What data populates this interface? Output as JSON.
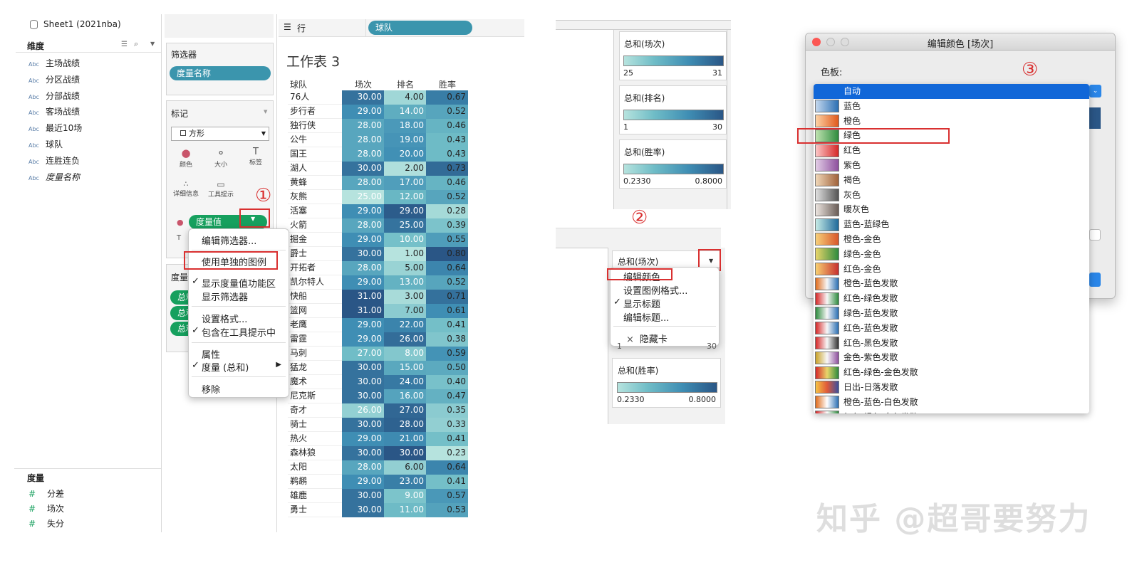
{
  "left_panel": {
    "sheet_title": "Sheet1 (2021nba)",
    "dimensions_label": "维度",
    "dimensions": [
      {
        "type": "Abc",
        "name": "主场战绩"
      },
      {
        "type": "Abc",
        "name": "分区战绩"
      },
      {
        "type": "Abc",
        "name": "分部战绩"
      },
      {
        "type": "Abc",
        "name": "客场战绩"
      },
      {
        "type": "Abc",
        "name": "最近10场"
      },
      {
        "type": "Abc",
        "name": "球队"
      },
      {
        "type": "Abc",
        "name": "连胜连负"
      },
      {
        "type": "Abc",
        "name": "度量名称"
      }
    ],
    "measures_label": "度量",
    "measures": [
      {
        "type": "#",
        "name": "分差"
      },
      {
        "type": "#",
        "name": "场次"
      },
      {
        "type": "#",
        "name": "失分"
      }
    ]
  },
  "filters": {
    "label": "筛选器",
    "pill": "度量名称"
  },
  "marks": {
    "label": "标记",
    "mark_type": "方形",
    "buttons": [
      "颜色",
      "大小",
      "标签",
      "详细信息",
      "工具提示"
    ],
    "pill": "度量值"
  },
  "measure_values_label": "度量",
  "measure_pills": [
    "总和",
    "总和",
    "总和"
  ],
  "rows": {
    "label": "行",
    "pill": "球队"
  },
  "sheet": {
    "title": "工作表 3",
    "headers": [
      "球队",
      "场次",
      "排名",
      "胜率"
    ],
    "rows": [
      [
        "76人",
        "30.00",
        "4.00",
        "0.67"
      ],
      [
        "步行者",
        "29.00",
        "14.00",
        "0.52"
      ],
      [
        "独行侠",
        "28.00",
        "18.00",
        "0.46"
      ],
      [
        "公牛",
        "28.00",
        "19.00",
        "0.43"
      ],
      [
        "国王",
        "28.00",
        "20.00",
        "0.43"
      ],
      [
        "湖人",
        "30.00",
        "2.00",
        "0.73"
      ],
      [
        "黄蜂",
        "28.00",
        "17.00",
        "0.46"
      ],
      [
        "灰熊",
        "25.00",
        "12.00",
        "0.52"
      ],
      [
        "活塞",
        "29.00",
        "29.00",
        "0.28"
      ],
      [
        "火箭",
        "28.00",
        "25.00",
        "0.39"
      ],
      [
        "掘金",
        "29.00",
        "10.00",
        "0.55"
      ],
      [
        "爵士",
        "30.00",
        "1.00",
        "0.80"
      ],
      [
        "开拓者",
        "28.00",
        "5.00",
        "0.64"
      ],
      [
        "凯尔特人",
        "29.00",
        "13.00",
        "0.52"
      ],
      [
        "快船",
        "31.00",
        "3.00",
        "0.71"
      ],
      [
        "篮网",
        "31.00",
        "7.00",
        "0.61"
      ],
      [
        "老鹰",
        "29.00",
        "22.00",
        "0.41"
      ],
      [
        "雷霆",
        "29.00",
        "26.00",
        "0.38"
      ],
      [
        "马刺",
        "27.00",
        "8.00",
        "0.59"
      ],
      [
        "猛龙",
        "30.00",
        "15.00",
        "0.50"
      ],
      [
        "魔术",
        "30.00",
        "24.00",
        "0.40"
      ],
      [
        "尼克斯",
        "30.00",
        "16.00",
        "0.47"
      ],
      [
        "奇才",
        "26.00",
        "27.00",
        "0.35"
      ],
      [
        "骑士",
        "30.00",
        "28.00",
        "0.33"
      ],
      [
        "热火",
        "29.00",
        "21.00",
        "0.41"
      ],
      [
        "森林狼",
        "30.00",
        "30.00",
        "0.23"
      ],
      [
        "太阳",
        "28.00",
        "6.00",
        "0.64"
      ],
      [
        "鹈鹕",
        "29.00",
        "23.00",
        "0.41"
      ],
      [
        "雄鹿",
        "30.00",
        "9.00",
        "0.57"
      ],
      [
        "勇士",
        "30.00",
        "11.00",
        "0.53"
      ]
    ]
  },
  "context_menu_1": {
    "items": [
      {
        "label": "编辑筛选器...",
        "check": false
      },
      {
        "label": "使用单独的图例",
        "check": false
      },
      {
        "label": "显示度量值功能区",
        "check": true
      },
      {
        "label": "显示筛选器",
        "check": false
      },
      {
        "label": "设置格式...",
        "check": false
      },
      {
        "label": "包含在工具提示中",
        "check": true
      },
      {
        "label": "属性",
        "check": false
      },
      {
        "label": "度量 (总和)",
        "check": true,
        "arrow": "▶"
      },
      {
        "label": "移除",
        "check": false
      }
    ]
  },
  "legends_top": [
    {
      "title": "总和(场次)",
      "min": "25",
      "max": "31"
    },
    {
      "title": "总和(排名)",
      "min": "1",
      "max": "30"
    },
    {
      "title": "总和(胜率)",
      "min": "0.2330",
      "max": "0.8000"
    }
  ],
  "legend_mid": {
    "title": "总和(场次)"
  },
  "legend_bottom": {
    "title": "总和(胜率)",
    "min": "0.2330",
    "max": "0.8000"
  },
  "context_menu_2": {
    "items": [
      {
        "label": "编辑颜色...",
        "check": false
      },
      {
        "label": "设置图例格式...",
        "check": false
      },
      {
        "label": "显示标题",
        "check": true
      },
      {
        "label": "编辑标题...",
        "check": false
      },
      {
        "label": "隐藏卡",
        "prefix": "×"
      }
    ]
  },
  "peek_values": {
    "a": "1",
    "b": "30"
  },
  "dialog": {
    "title": "编辑颜色 [场次]",
    "palette_label": "色板:",
    "palettes": [
      {
        "name": "自动",
        "selected": true
      },
      {
        "name": "蓝色"
      },
      {
        "name": "橙色"
      },
      {
        "name": "绿色"
      },
      {
        "name": "红色"
      },
      {
        "name": "紫色"
      },
      {
        "name": "褐色"
      },
      {
        "name": "灰色"
      },
      {
        "name": "暖灰色"
      },
      {
        "name": "蓝色-蓝绿色"
      },
      {
        "name": "橙色-金色"
      },
      {
        "name": "绿色-金色"
      },
      {
        "name": "红色-金色"
      },
      {
        "name": "橙色-蓝色发散"
      },
      {
        "name": "红色-绿色发散"
      },
      {
        "name": "绿色-蓝色发散"
      },
      {
        "name": "红色-蓝色发散"
      },
      {
        "name": "红色-黑色发散"
      },
      {
        "name": "金色-紫色发散"
      },
      {
        "name": "红色-绿色-金色发散"
      },
      {
        "name": "日出-日落发散"
      },
      {
        "name": "橙色-蓝色-白色发散"
      },
      {
        "name": "红色-绿色-白色发散"
      }
    ]
  },
  "annotations": {
    "one": "①",
    "two": "②",
    "three": "③"
  },
  "watermark": "知乎 @超哥要努力"
}
